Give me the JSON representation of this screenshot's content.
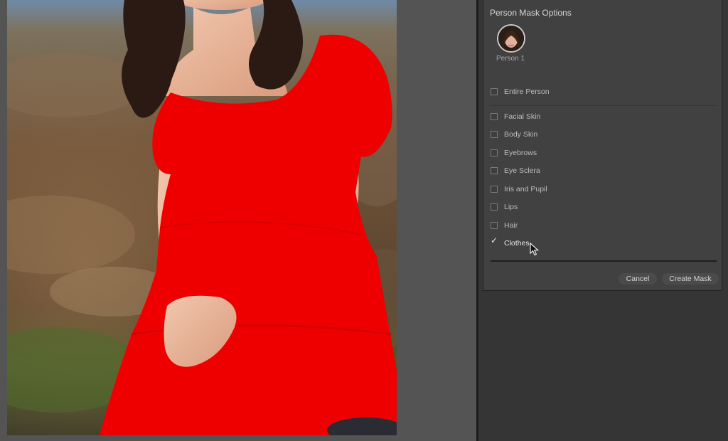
{
  "panel": {
    "title": "Person Mask Options",
    "person": {
      "label": "Person 1",
      "selected": true
    },
    "entire_person": {
      "label": "Entire Person",
      "checked": false
    },
    "options": [
      {
        "label": "Facial Skin",
        "checked": false
      },
      {
        "label": "Body Skin",
        "checked": false
      },
      {
        "label": "Eyebrows",
        "checked": false
      },
      {
        "label": "Eye Sclera",
        "checked": false
      },
      {
        "label": "Iris and Pupil",
        "checked": false
      },
      {
        "label": "Lips",
        "checked": false
      },
      {
        "label": "Hair",
        "checked": false
      },
      {
        "label": "Clothes",
        "checked": true
      }
    ],
    "check_glyph": "✓",
    "buttons": {
      "cancel": "Cancel",
      "create": "Create Mask"
    }
  },
  "colors": {
    "mask_overlay": "#ee0000",
    "panel_bg": "#414141",
    "text": "#bdbdbd"
  },
  "icons": {
    "checkbox_checked": "check-icon",
    "cursor": "pointer-cursor-icon"
  }
}
